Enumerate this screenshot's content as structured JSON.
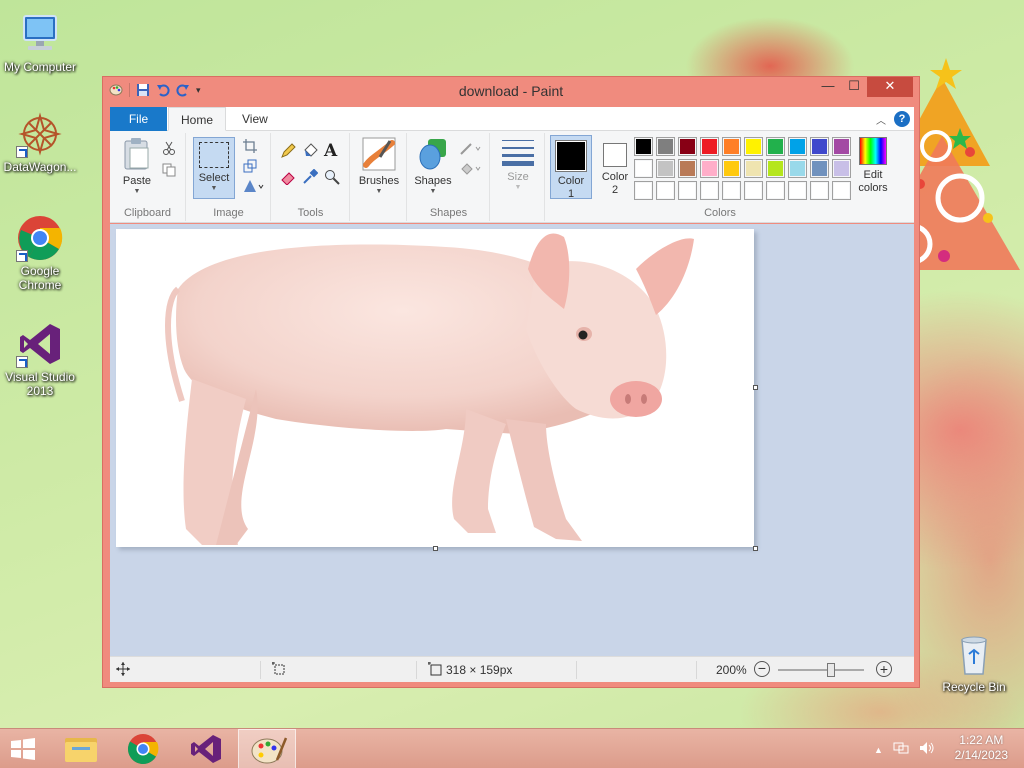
{
  "desktop": {
    "icons": [
      {
        "label": "My Computer"
      },
      {
        "label": "DataWagon..."
      },
      {
        "label": "Google Chrome"
      },
      {
        "label": "Visual Studio 2013"
      },
      {
        "label": "Recycle Bin"
      }
    ]
  },
  "window": {
    "title": "download - Paint",
    "controls": {
      "minimize": "—",
      "maximize": "☐",
      "close": "✕"
    },
    "help_label": "?"
  },
  "tabs": {
    "file": "File",
    "home": "Home",
    "view": "View"
  },
  "ribbon": {
    "clipboard": {
      "paste": "Paste",
      "group_label": "Clipboard"
    },
    "image": {
      "select": "Select",
      "group_label": "Image"
    },
    "tools": {
      "group_label": "Tools"
    },
    "brushes": {
      "label": "Brushes"
    },
    "shapes": {
      "label": "Shapes",
      "group_label": "Shapes"
    },
    "size": {
      "label": "Size"
    },
    "color1": {
      "line1": "Color",
      "line2": "1"
    },
    "color2": {
      "line1": "Color",
      "line2": "2"
    },
    "colors": {
      "group_label": "Colors",
      "row1": [
        "#000000",
        "#7f7f7f",
        "#880015",
        "#ed1c24",
        "#ff7f27",
        "#fff200",
        "#22b14c",
        "#00a2e8",
        "#3f48cc",
        "#a349a4"
      ],
      "row2": [
        "#ffffff",
        "#c3c3c3",
        "#b97a57",
        "#ffaec9",
        "#ffc90e",
        "#efe4b0",
        "#b5e61d",
        "#99d9ea",
        "#7092be",
        "#c8bfe7"
      ],
      "row3": [
        "",
        "",
        "",
        "",
        "",
        "",
        "",
        "",
        "",
        ""
      ],
      "color1_value": "#000000",
      "color2_value": "#ffffff"
    },
    "edit_colors": {
      "line1": "Edit",
      "line2": "colors"
    }
  },
  "status": {
    "dimensions": "318 × 159px",
    "zoom": "200%",
    "zoom_level": 0.62
  },
  "taskbar": {
    "time": "1:22 AM",
    "date": "2/14/2023"
  }
}
